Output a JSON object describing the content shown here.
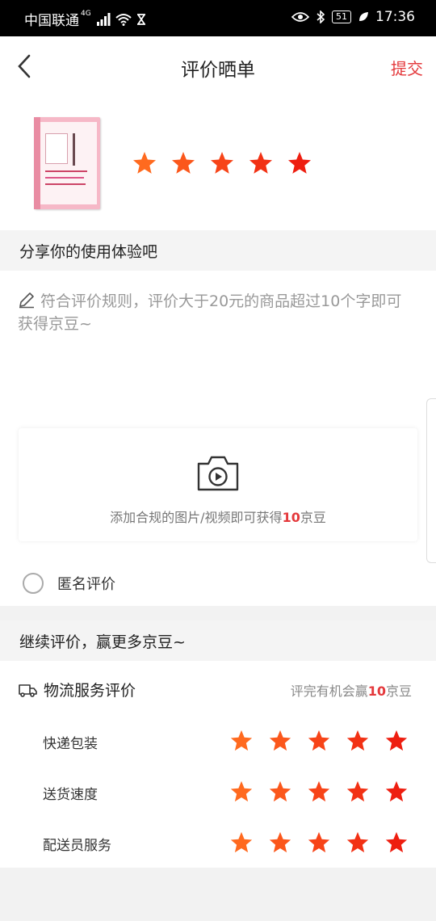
{
  "status_bar": {
    "carrier": "中国联通",
    "network": "4G",
    "battery": "51",
    "time": "17:36"
  },
  "header": {
    "title": "评价晒单",
    "submit_label": "提交"
  },
  "product": {
    "rating": 5,
    "max_rating": 5
  },
  "share_section": {
    "title": "分享你的使用体验吧",
    "placeholder": "符合评价规则，评价大于20元的商品超过10个字即可获得京豆~"
  },
  "upload": {
    "text_before": "添加合规的图片/视频即可获得",
    "amount": "10",
    "text_after": "京豆"
  },
  "anonymous": {
    "label": "匿名评价",
    "checked": false
  },
  "continue_section": {
    "title": "继续评价，赢更多京豆~"
  },
  "logistics": {
    "title": "物流服务评价",
    "note_before": "评完有机会赢",
    "note_amount": "10",
    "note_after": "京豆",
    "rows": [
      {
        "label": "快递包装",
        "rating": 5
      },
      {
        "label": "送货速度",
        "rating": 5
      },
      {
        "label": "配送员服务",
        "rating": 5
      }
    ]
  },
  "colors": {
    "accent": "#e4393c",
    "star_gradient": [
      "#ff6a1f",
      "#ee1e10"
    ]
  }
}
